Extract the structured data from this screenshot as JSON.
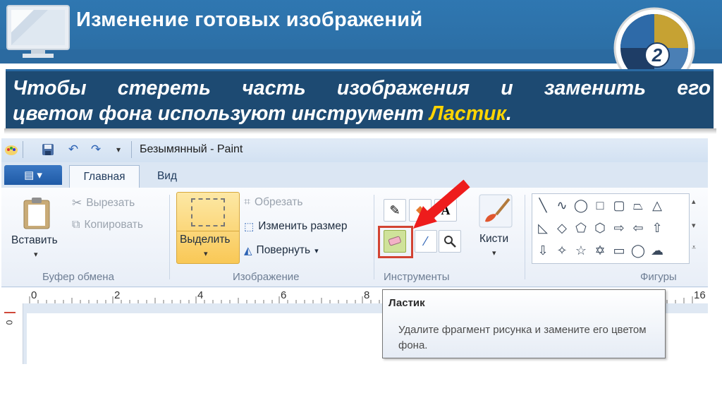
{
  "slide": {
    "title": "Изменение готовых изображений",
    "badge_number": "2",
    "text_line1": "Чтобы стереть часть изображения и заменить его",
    "text_line2_prefix": "цветом фона используют инструмент ",
    "text_highlight": "Ластик",
    "text_suffix": ".",
    "highlight_color": "#ffd400",
    "panel_color": "#1d4a72",
    "header_color": "#2f77b1"
  },
  "paint": {
    "window_title": "Безымянный - Paint",
    "tabs": {
      "home": "Главная",
      "view": "Вид"
    },
    "clipboard": {
      "paste": "Вставить",
      "cut": "Вырезать",
      "copy": "Копировать",
      "group": "Буфер обмена"
    },
    "image": {
      "select": "Выделить",
      "crop": "Обрезать",
      "resize": "Изменить размер",
      "rotate": "Повернуть",
      "group": "Изображение"
    },
    "tools": {
      "group": "Инструменты",
      "brushes": "Кисти"
    },
    "shapes": {
      "group": "Фигуры"
    },
    "ruler": [
      "0",
      "2",
      "4",
      "6",
      "8",
      "16"
    ],
    "vruler": "0",
    "tooltip": {
      "title": "Ластик",
      "description": "Удалите фрагмент рисунка и замените его цветом фона."
    }
  }
}
